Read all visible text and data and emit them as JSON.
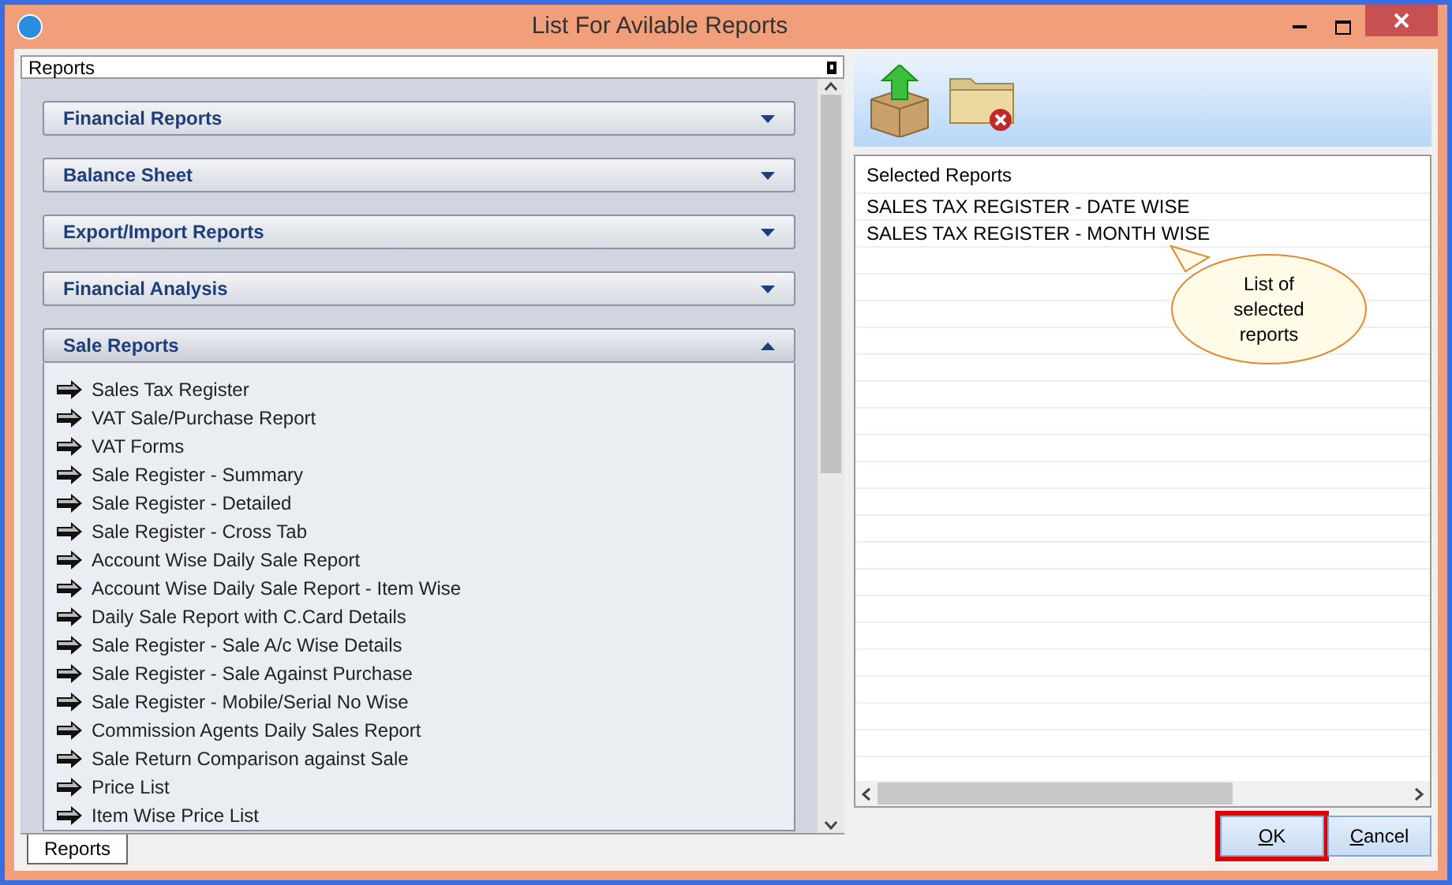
{
  "window": {
    "title": "List For Avilable Reports"
  },
  "left_panel": {
    "title": "Reports",
    "bottom_tab": "Reports"
  },
  "groups": [
    {
      "label": "Financial Reports",
      "expanded": false
    },
    {
      "label": "Balance Sheet",
      "expanded": false
    },
    {
      "label": "Export/Import Reports",
      "expanded": false
    },
    {
      "label": "Financial Analysis",
      "expanded": false
    },
    {
      "label": "Sale Reports",
      "expanded": true,
      "items": [
        "Sales Tax Register",
        "VAT Sale/Purchase Report",
        "VAT Forms",
        "Sale Register - Summary",
        "Sale Register - Detailed",
        "Sale Register - Cross Tab",
        "Account Wise Daily Sale Report",
        "Account Wise Daily Sale Report - Item Wise",
        "Daily Sale Report with C.Card Details",
        "Sale Register - Sale A/c Wise Details",
        "Sale Register - Sale Against Purchase",
        "Sale Register - Mobile/Serial No Wise",
        "Commission Agents Daily Sales Report",
        "Sale Return Comparison against Sale",
        "Price List",
        "Item Wise Price List"
      ]
    }
  ],
  "selected_list": {
    "header": "Selected Reports",
    "rows": [
      "SALES TAX REGISTER - DATE WISE",
      "SALES TAX REGISTER - MONTH WISE"
    ]
  },
  "callout": "List of selected reports",
  "buttons": [
    {
      "label": "OK",
      "highlighted": true
    },
    {
      "label": "Cancel",
      "highlighted": false
    }
  ]
}
